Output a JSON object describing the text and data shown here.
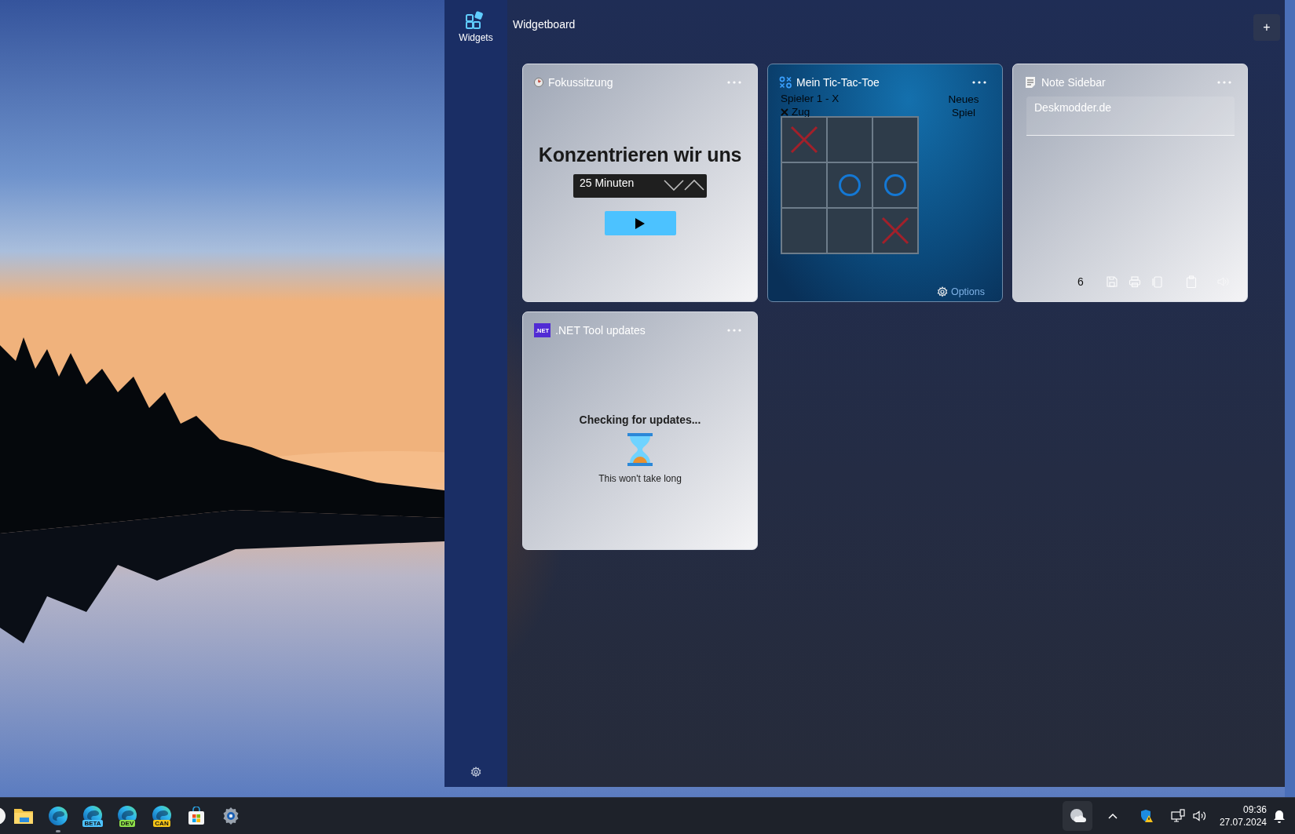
{
  "sidebar": {
    "items": [
      {
        "label": "Widgets",
        "selected": true
      }
    ]
  },
  "header": {
    "title": "Widgetboard",
    "add_button": "+"
  },
  "widgets": [
    {
      "kind": "focus",
      "title": "Fokussitzung",
      "heading": "Konzentrieren wir uns",
      "duration": "25 Minuten"
    },
    {
      "kind": "tictactoe",
      "title": "Mein Tic-Tac-Toe",
      "player": "Spieler 1 - X",
      "turn": {
        "kind": "x",
        "label": "Zug"
      },
      "new_game": "Neues Spiel",
      "options": "Options",
      "board": [
        {
          "kind": "x"
        },
        {
          "kind": "empty"
        },
        {
          "kind": "empty"
        },
        {
          "kind": "empty"
        },
        {
          "kind": "o"
        },
        {
          "kind": "o"
        },
        {
          "kind": "empty"
        },
        {
          "kind": "empty"
        },
        {
          "kind": "x"
        }
      ]
    },
    {
      "kind": "note",
      "title": "Note Sidebar",
      "text": "Deskmodder.de",
      "count": "6"
    },
    {
      "kind": "dotnet",
      "title": ".NET Tool updates",
      "icon_label": ".NET",
      "status": "Checking for updates...",
      "hint": "This won't take long"
    }
  ],
  "taskbar": {
    "apps": [
      {
        "kind": "start",
        "running": false
      },
      {
        "kind": "folder",
        "running": false
      },
      {
        "kind": "browser",
        "running": true
      },
      {
        "kind": "browser",
        "badge": "BETA",
        "color": "#4cc2ff",
        "running": false
      },
      {
        "kind": "browser",
        "badge": "DEV",
        "color": "#8ee04a",
        "running": false
      },
      {
        "kind": "browser",
        "badge": "CAN",
        "color": "#f5c518",
        "running": false
      },
      {
        "kind": "store",
        "running": false
      },
      {
        "kind": "settings",
        "running": false
      }
    ],
    "time": "09:36",
    "date": "27.07.2024"
  }
}
